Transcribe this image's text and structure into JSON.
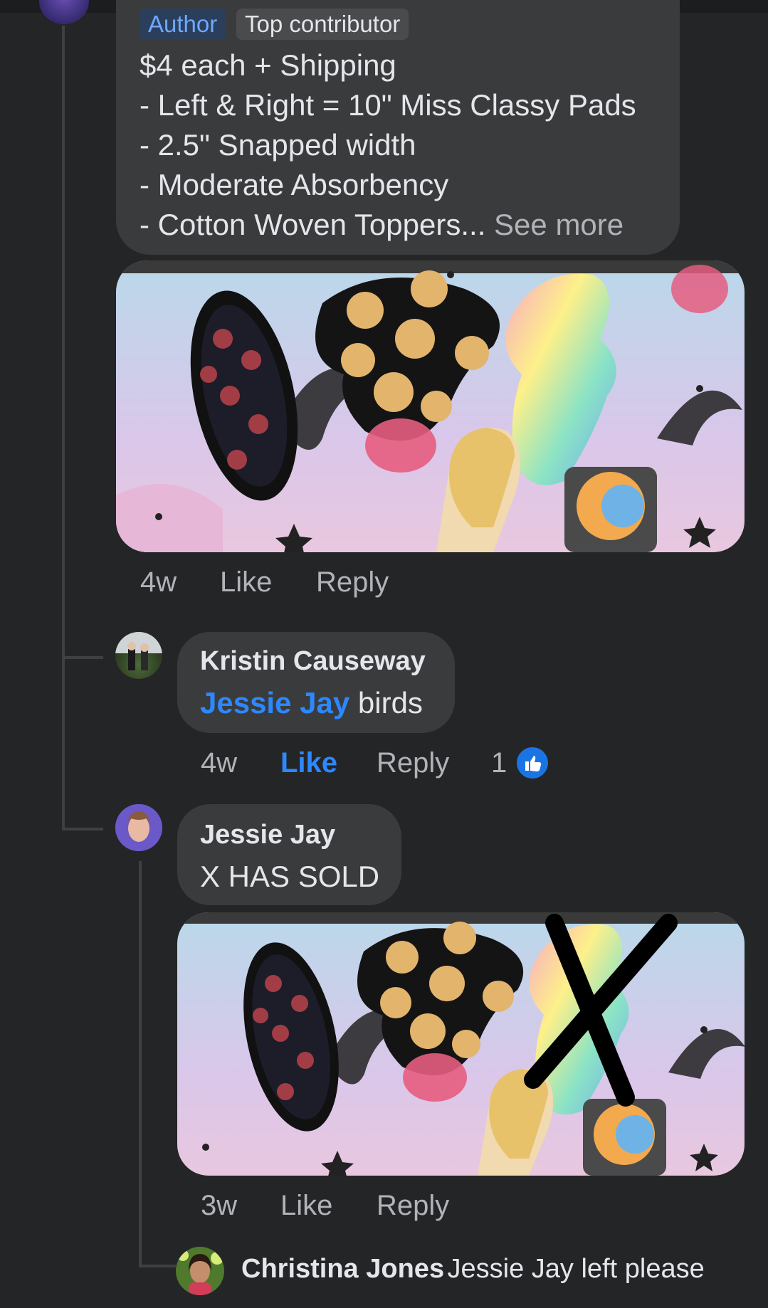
{
  "post": {
    "badges": {
      "author": "Author",
      "top_contributor": "Top contributor"
    },
    "lines": [
      "$4 each + Shipping",
      "- Left & Right = 10\" Miss Classy Pads",
      "- 2.5\" Snapped width",
      "- Moderate Absorbency",
      "- Cotton Woven Toppers..."
    ],
    "see_more": "See more",
    "actions": {
      "time": "4w",
      "like": "Like",
      "reply": "Reply"
    }
  },
  "comments": [
    {
      "author": "Kristin Causeway",
      "mention": "Jessie Jay",
      "text": "birds",
      "actions": {
        "time": "4w",
        "like": "Like",
        "reply": "Reply"
      },
      "reaction_count": "1",
      "reaction_icon": "thumbs-up-icon"
    },
    {
      "author": "Jessie Jay",
      "text": "X HAS SOLD",
      "actions": {
        "time": "3w",
        "like": "Like",
        "reply": "Reply"
      }
    },
    {
      "author": "Christina Jones",
      "text": "Jessie Jay left please"
    }
  ],
  "colors": {
    "background": "#242526",
    "bubble": "#3a3b3c",
    "accent": "#2d88ff",
    "text": "#e4e6eb",
    "muted": "#b0b3b8"
  }
}
